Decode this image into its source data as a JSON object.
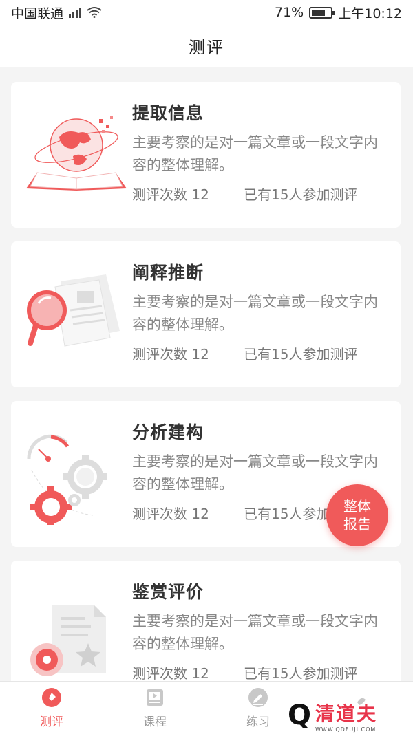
{
  "status_bar": {
    "carrier": "中国联通",
    "battery": "71%",
    "time": "上午10:12"
  },
  "header": {
    "title": "测评"
  },
  "cards": [
    {
      "title": "提取信息",
      "description": "主要考察的是对一篇文章或一段文字内容的整体理解。",
      "count": "测评次数 12",
      "participants": "已有15人参加测评",
      "icon": "globe-book-icon"
    },
    {
      "title": "阐释推断",
      "description": "主要考察的是对一篇文章或一段文字内容的整体理解。",
      "count": "测评次数 12",
      "participants": "已有15人参加测评",
      "icon": "magnifier-document-icon"
    },
    {
      "title": "分析建构",
      "description": "主要考察的是对一篇文章或一段文字内容的整体理解。",
      "count": "测评次数 12",
      "participants": "已有15人参加测评",
      "icon": "gears-gauge-icon"
    },
    {
      "title": "鉴赏评价",
      "description": "主要考察的是对一篇文章或一段文字内容的整体理解。",
      "count": "测评次数 12",
      "participants": "已有15人参加测评",
      "icon": "document-star-icon"
    }
  ],
  "fab": {
    "line1": "整体",
    "line2": "报告"
  },
  "tabs": [
    {
      "label": "测评",
      "active": true
    },
    {
      "label": "课程",
      "active": false
    },
    {
      "label": "练习",
      "active": false
    },
    {
      "label": "",
      "active": false
    }
  ],
  "watermark": {
    "name": "清道夫",
    "url": "WWW.QDFUJI.COM"
  },
  "colors": {
    "accent": "#f05a5a",
    "text": "#333333",
    "muted": "#888888"
  }
}
